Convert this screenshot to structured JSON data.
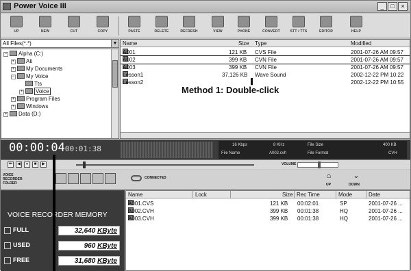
{
  "window": {
    "title": "Power Voice III",
    "controls": [
      "_",
      "□",
      "×"
    ]
  },
  "toolbar": {
    "buttons": [
      {
        "label": "UP",
        "icon": "up-icon"
      },
      {
        "label": "NEW",
        "icon": "new-folder-icon"
      },
      {
        "label": "CUT",
        "icon": "cut-icon"
      },
      {
        "label": "COPY",
        "icon": "copy-icon"
      },
      {
        "label": "PASTE",
        "icon": "paste-icon"
      },
      {
        "label": "DELETE",
        "icon": "delete-icon"
      },
      {
        "label": "REFRESH",
        "icon": "refresh-icon"
      },
      {
        "label": "VIEW",
        "icon": "view-icon"
      },
      {
        "label": "PHONE",
        "icon": "phone-icon"
      },
      {
        "label": "CONVERT",
        "icon": "convert-icon"
      },
      {
        "label": "STT / TTS",
        "icon": "stt-tts-icon"
      },
      {
        "label": "EDITOR",
        "icon": "editor-icon"
      },
      {
        "label": "HELP",
        "icon": "help-icon"
      }
    ]
  },
  "filter": {
    "value": "All Files(*.*)"
  },
  "tree": {
    "items": [
      {
        "label": "Alpha (C:)",
        "pm": "−"
      },
      {
        "label": "Ati",
        "pm": "+"
      },
      {
        "label": "My Documents",
        "pm": "+"
      },
      {
        "label": "My Voice",
        "pm": "−"
      },
      {
        "label": "Tts",
        "pm": ""
      },
      {
        "label": "Voice",
        "pm": "+"
      },
      {
        "label": "Program Files",
        "pm": "+"
      },
      {
        "label": "Windows",
        "pm": "+"
      },
      {
        "label": "Data (D:)",
        "pm": "+"
      }
    ]
  },
  "files": {
    "headers": {
      "name": "Name",
      "size": "Size",
      "type": "Type",
      "modified": "Modified"
    },
    "rows": [
      {
        "name": "A001",
        "size": "121 KB",
        "type": "CVS File",
        "modified": "2001-07-26 AM 09:57"
      },
      {
        "name": "A002",
        "size": "399 KB",
        "type": "CVN File",
        "modified": "2001-07-26 AM 09:57"
      },
      {
        "name": "A003",
        "size": "399 KB",
        "type": "CVN File",
        "modified": "2001-07-26 AM 09:57"
      },
      {
        "name": "Lesson1",
        "size": "37,126 KB",
        "type": "Wave Sound",
        "modified": "2002-12-22 PM 10:22"
      },
      {
        "name": "Lesson2",
        "size": "",
        "type": "",
        "modified": "2002-12-22 PM 10:55"
      }
    ],
    "callout": "Method 1: Double-click"
  },
  "player": {
    "time": "00:00:04",
    "total": "00:01:38",
    "info": {
      "bitrate": "16 Kbps",
      "freq": "8 KHz",
      "file_size_label": "File Size",
      "file_size": "400 KB",
      "file_name_label": "File Name",
      "file_name": "A002.cvh",
      "format_label": "File Format",
      "format": "CVH"
    },
    "controls": [
      "⏮",
      "◀",
      "⏸",
      "■",
      "▶"
    ],
    "volume_label": "VOLUME"
  },
  "recorder": {
    "folder_label_1": "VOICE",
    "folder_label_2": "RECORDER",
    "folder_label_3": "FOLDER",
    "connected_label": "CONNECTED",
    "up_label": "UP",
    "down_label": "DOWN"
  },
  "memory": {
    "title": "VOICE RECORDER MEMORY",
    "full_label": "FULL",
    "full_value": "32,640",
    "unit": "KByte",
    "used_label": "USED",
    "used_value": "960",
    "free_label": "FREE",
    "free_value": "31,680"
  },
  "recorder_files": {
    "headers": {
      "name": "Name",
      "lock": "Lock",
      "size": "Size",
      "rec_time": "Rec Time",
      "mode": "Mode",
      "date": "Date"
    },
    "rows": [
      {
        "name": "A001.CVS",
        "lock": "",
        "size": "121 KB",
        "rec_time": "00:02:01",
        "mode": "SP",
        "date": "2001-07-26 ..."
      },
      {
        "name": "A002.CVH",
        "lock": "",
        "size": "399 KB",
        "rec_time": "00:01:38",
        "mode": "HQ",
        "date": "2001-07-26 ..."
      },
      {
        "name": "A003.CVH",
        "lock": "",
        "size": "399 KB",
        "rec_time": "00:01:38",
        "mode": "HQ",
        "date": "2001-07-26 ..."
      }
    ]
  }
}
